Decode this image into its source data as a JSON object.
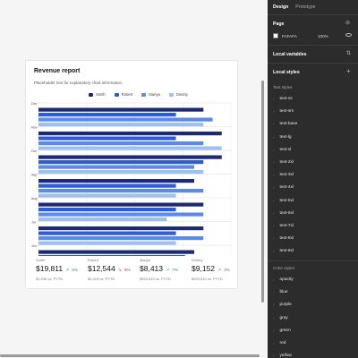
{
  "card": {
    "title": "Revenue report",
    "subtitle": "Placeholder text for explanatory chart information."
  },
  "colors": {
    "smith": "#1b2a72",
    "robert": "#2f5bd8",
    "mariya": "#5b8be8",
    "dmitriy": "#9cc0f2",
    "up": "#1e9a4a",
    "down": "#d8342b"
  },
  "chart_data": {
    "type": "bar",
    "orientation": "horizontal",
    "categories": [
      "Dec",
      "Nov",
      "Oct",
      "Sep",
      "Aug",
      "Jul",
      "Jun"
    ],
    "series": [
      {
        "name": "Smith",
        "values": [
          36,
          40,
          40,
          34,
          36,
          36,
          34
        ]
      },
      {
        "name": "Robert",
        "values": [
          30,
          30,
          36,
          30,
          30,
          30,
          32
        ]
      },
      {
        "name": "Mariya",
        "values": [
          38,
          36,
          34,
          36,
          36,
          36,
          36
        ]
      },
      {
        "name": "Dmitriy",
        "values": [
          36,
          40,
          36,
          30,
          28,
          30,
          28
        ]
      }
    ],
    "xlim": [
      0,
      42
    ],
    "grid": true,
    "legend": "top"
  },
  "kpis": [
    {
      "name": "Smith",
      "value": "$19,811",
      "arrow": "↗",
      "pct": "6%",
      "dir": "up",
      "foot": "$1,936 vs. PYTD"
    },
    {
      "name": "Robert",
      "value": "$12,544",
      "arrow": "↘",
      "pct": "9%",
      "dir": "down",
      "foot": "$2,419 vs. PYTD"
    },
    {
      "name": "Mariya",
      "value": "$8,413",
      "arrow": "↗",
      "pct": "7%",
      "dir": "up",
      "foot": "$923,510 vs. PYTD"
    },
    {
      "name": "Dmitriy",
      "value": "$9,152",
      "arrow": "↗",
      "pct": "3%",
      "dir": "up",
      "foot": "$923,510 vs. PYTD"
    }
  ],
  "panel": {
    "tabs": [
      "Design",
      "Prototype"
    ],
    "page_label": "Page",
    "page_color": "FAFAFA",
    "page_opacity": "100%",
    "local_variables": "Local variables",
    "local_styles": "Local styles",
    "text_styles_label": "Text styles",
    "text_styles": [
      "text-xs",
      "text-sm",
      "text-base",
      "text-lg",
      "text-xl",
      "text-2xl",
      "text-3xl",
      "text-4xl",
      "text-5xl",
      "text-6xl",
      "text-7xl",
      "text-8xl",
      "text-9xl"
    ],
    "color_styles_label": "Color styles",
    "color_styles": [
      "opacity",
      "blue",
      "purple",
      "gray",
      "green",
      "red",
      "yellow"
    ]
  }
}
